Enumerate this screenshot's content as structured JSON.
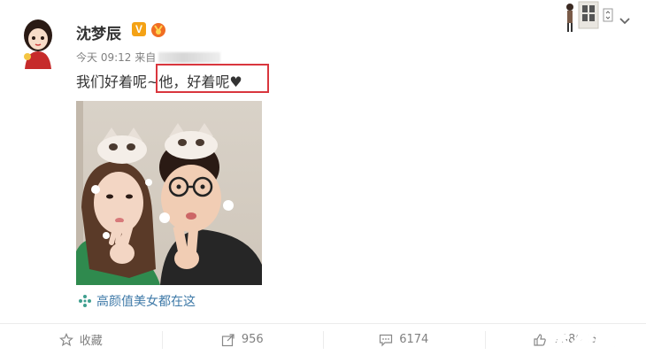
{
  "author": {
    "name": "沈梦辰",
    "verified_badge": "V"
  },
  "meta": {
    "time": "今天 09:12 来自"
  },
  "post": {
    "text_before": "我们好着呢~",
    "text_highlight": "他，好着呢♥"
  },
  "location": {
    "label": "高颜值美女都在这"
  },
  "actions": [
    {
      "icon": "star-icon",
      "label": "收藏"
    },
    {
      "icon": "share-icon",
      "label": "956"
    },
    {
      "icon": "comment-icon",
      "label": "6174"
    },
    {
      "icon": "like-icon",
      "label": "138605"
    }
  ],
  "watermark": "广东龙网",
  "colors": {
    "highlight_border": "#d9363e",
    "link": "#3f7aa8",
    "badge": "#f4a215"
  }
}
